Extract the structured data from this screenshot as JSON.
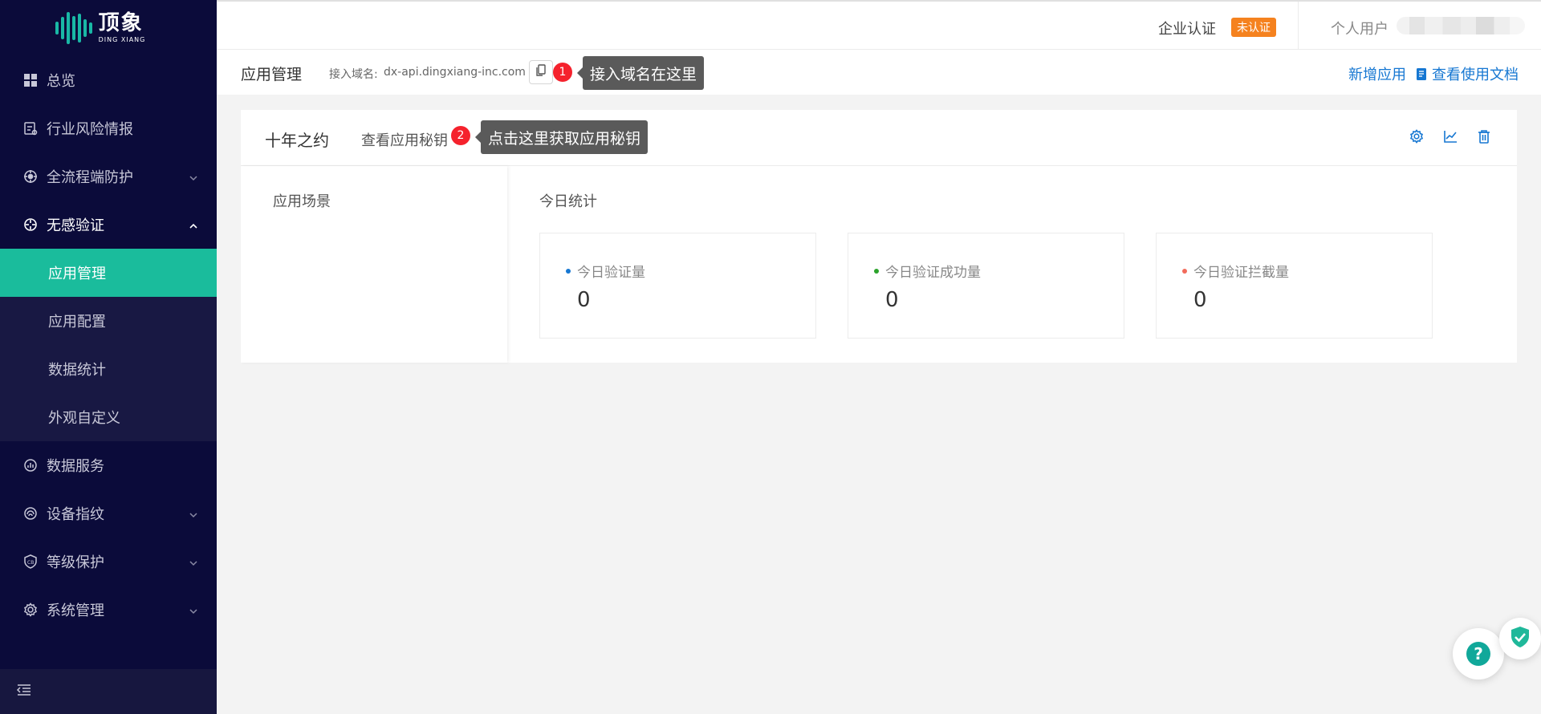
{
  "brand": {
    "name_cn": "顶象",
    "name_en": "DING XIANG"
  },
  "sidebar": {
    "items": [
      {
        "label": "总览",
        "icon": "grid-icon"
      },
      {
        "label": "行业风险情报",
        "icon": "report-icon"
      },
      {
        "label": "全流程端防护",
        "icon": "target-icon"
      },
      {
        "label": "无感验证",
        "icon": "crosshair-icon"
      },
      {
        "label": "数据服务",
        "icon": "chart-icon"
      },
      {
        "label": "设备指纹",
        "icon": "fingerprint-icon"
      },
      {
        "label": "等级保护",
        "icon": "shield-icon"
      },
      {
        "label": "系统管理",
        "icon": "gear-icon"
      }
    ],
    "subitems": [
      "应用管理",
      "应用配置",
      "数据统计",
      "外观自定义"
    ],
    "active_subitem": "应用管理"
  },
  "header": {
    "cert_label": "企业认证",
    "cert_status": "未认证",
    "user_label": "个人用户",
    "cert_status_color": "#f5821f"
  },
  "subheader": {
    "title": "应用管理",
    "domain_label": "接入域名:",
    "domain_value": "dx-api.dingxiang-inc.com",
    "add_app": "新增应用",
    "view_docs": "查看使用文档"
  },
  "tips": [
    {
      "num": "1",
      "text": "接入域名在这里"
    },
    {
      "num": "2",
      "text": "点击这里获取应用秘钥"
    }
  ],
  "app_card": {
    "name": "十年之约",
    "secret_link": "查看应用秘钥",
    "scene_label": "应用场景",
    "stats_title": "今日统计",
    "stats": [
      {
        "label": "今日验证量",
        "value": "0",
        "color": "#1677d2"
      },
      {
        "label": "今日验证成功量",
        "value": "0",
        "color": "#2ba32b"
      },
      {
        "label": "今日验证拦截量",
        "value": "0",
        "color": "#f26b5b"
      }
    ]
  },
  "accent_color": "#1abc9c",
  "link_color": "#1677d2"
}
